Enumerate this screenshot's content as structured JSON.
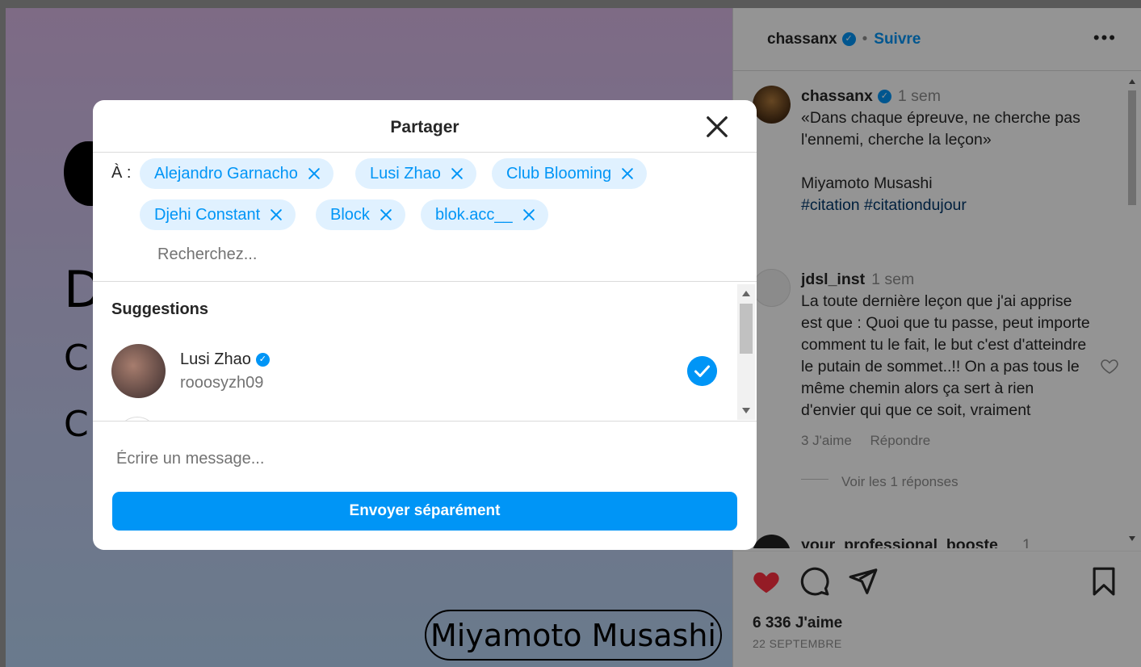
{
  "background_post": {
    "author_caption": "Miyamoto Musashi",
    "letters": [
      "D",
      "C",
      "C"
    ]
  },
  "side_panel": {
    "header": {
      "username": "chassanx",
      "separator": "•",
      "follow_label": "Suivre",
      "more_label": "•••"
    },
    "caption": {
      "author": "chassanx",
      "time": "1 sem",
      "text_line1": "«Dans chaque épreuve, ne cherche pas l'ennemi, cherche la leçon»",
      "text_line2": "Miyamoto Musashi",
      "hashtags": "#citation #citationdujour"
    },
    "comment": {
      "author": "jdsl_inst",
      "time": "1 sem",
      "text": "La toute dernière leçon que j'ai apprise est que : Quoi que tu passe, peut importe comment tu le fait, le but c'est d'atteindre le putain de sommet..!! On a pas tous le même chemin alors ça sert à rien d'envier qui que ce soit, vraiment",
      "likes": "3 J'aime",
      "reply_label": "Répondre",
      "view_replies": "Voir les 1 réponses"
    },
    "next_comment_author": "your_professional_booste",
    "next_comment_time": "1",
    "likes_count": "6 336 J'aime",
    "date": "22 SEPTEMBRE"
  },
  "share_modal": {
    "title": "Partager",
    "to_label": "À :",
    "recipients": [
      "Alejandro Garnacho",
      "Lusi Zhao",
      "Club Blooming",
      "Djehi Constant",
      "Block",
      "blok.acc__"
    ],
    "search_placeholder": "Recherchez...",
    "suggestions_title": "Suggestions",
    "suggestion": {
      "name": "Lusi Zhao",
      "handle": "rooosyzh09",
      "selected": true
    },
    "message_placeholder": "Écrire un message...",
    "send_label": "Envoyer séparément"
  },
  "colors": {
    "accent": "#0095f6",
    "chip_bg": "#e0f1ff",
    "heart": "#ff3040"
  }
}
